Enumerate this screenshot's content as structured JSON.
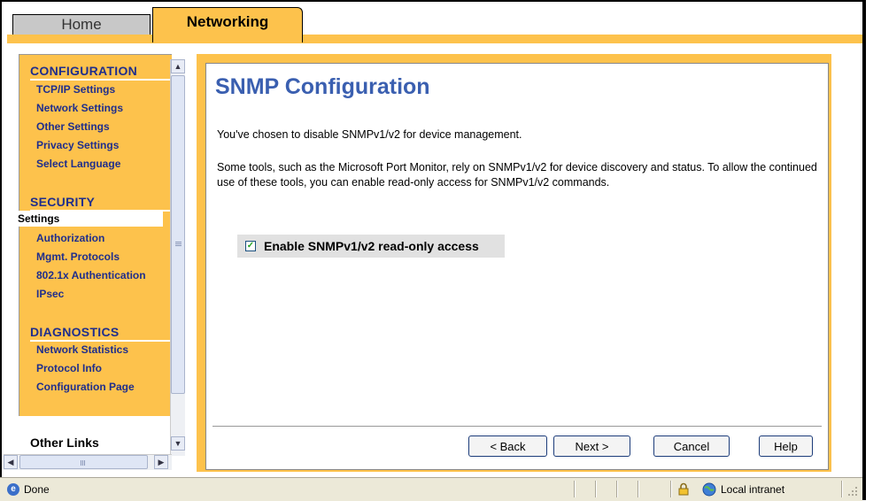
{
  "tabs": {
    "home": "Home",
    "networking": "Networking"
  },
  "sidebar": {
    "configuration": {
      "title": "CONFIGURATION",
      "items": [
        "TCP/IP Settings",
        "Network Settings",
        "Other Settings",
        "Privacy Settings",
        "Select Language"
      ]
    },
    "security": {
      "title": "SECURITY",
      "selected": "Settings",
      "items": [
        "Authorization",
        "Mgmt. Protocols",
        "802.1x Authentication",
        "IPsec"
      ]
    },
    "diagnostics": {
      "title": "DIAGNOSTICS",
      "items": [
        "Network Statistics",
        "Protocol Info",
        "Configuration Page"
      ]
    },
    "other_links": "Other Links"
  },
  "main": {
    "title": "SNMP Configuration",
    "paragraph1": "You've chosen to disable SNMPv1/v2 for device management.",
    "paragraph2": "Some tools, such as the Microsoft Port Monitor, rely on SNMPv1/v2 for device discovery and status. To allow the continued use of these tools, you can enable read-only access for SNMPv1/v2 commands.",
    "option_label": "Enable SNMPv1/v2 read-only access",
    "option_checked": true
  },
  "buttons": {
    "back": "< Back",
    "next": "Next >",
    "cancel": "Cancel",
    "help": "Help"
  },
  "statusbar": {
    "text": "Done",
    "zone": "Local intranet"
  },
  "colors": {
    "accent": "#fdc24c",
    "title": "#3a5fb0",
    "nav_text": "#1f2e8c"
  },
  "icons": [
    "ie-page-icon",
    "lock-icon",
    "globe-icon",
    "resize-grip-icon",
    "chevron-up-icon",
    "chevron-down-icon",
    "chevron-left-icon",
    "chevron-right-icon",
    "checkmark-icon"
  ]
}
